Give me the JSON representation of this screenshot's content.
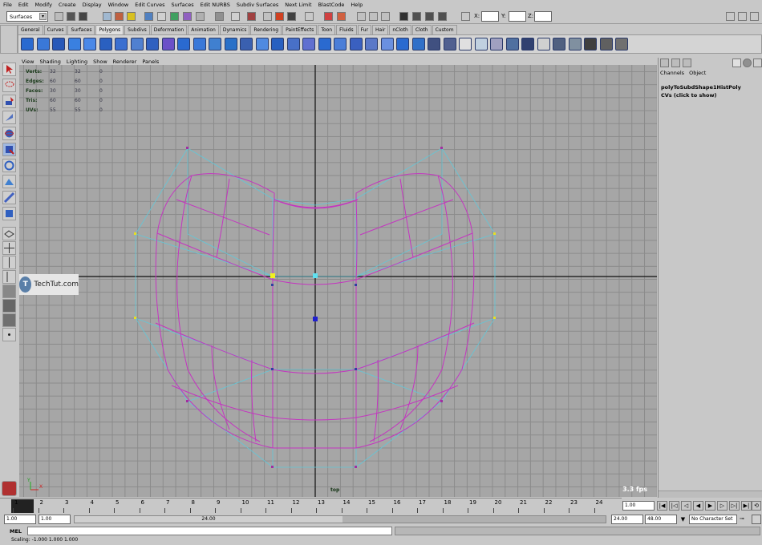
{
  "menubar": [
    "File",
    "Edit",
    "Modify",
    "Create",
    "Display",
    "Window",
    "Edit Curves",
    "Surfaces",
    "Edit NURBS",
    "Subdiv Surfaces",
    "Next Limit",
    "BlastCode",
    "Help"
  ],
  "status_line": {
    "mode": "Surfaces",
    "x_label": "X:",
    "y_label": "Y:",
    "z_label": "Z:"
  },
  "shelf_tabs": [
    "General",
    "Curves",
    "Surfaces",
    "Polygons",
    "Subdivs",
    "Deformation",
    "Animation",
    "Dynamics",
    "Rendering",
    "PaintEffects",
    "Toon",
    "Fluids",
    "Fur",
    "Hair",
    "nCloth",
    "Cloth",
    "Custom"
  ],
  "active_shelf_tab": "Polygons",
  "panel_menu": [
    "View",
    "Shading",
    "Lighting",
    "Show",
    "Renderer",
    "Panels"
  ],
  "hud": {
    "rows": [
      {
        "label": "Verts:",
        "a": "32",
        "b": "32",
        "c": "0"
      },
      {
        "label": "Edges:",
        "a": "60",
        "b": "60",
        "c": "0"
      },
      {
        "label": "Faces:",
        "a": "30",
        "b": "30",
        "c": "0"
      },
      {
        "label": "Tris:",
        "a": "60",
        "b": "60",
        "c": "0"
      },
      {
        "label": "UVs:",
        "a": "55",
        "b": "55",
        "c": "0"
      }
    ]
  },
  "viewport": {
    "camera": "top",
    "fps": "3.3 fps",
    "axis_y": "Y",
    "axis_x": "X"
  },
  "watermark": "TechTut.com",
  "channel_box": {
    "menu": [
      "Channels",
      "Object"
    ],
    "node": "polyToSubdShape1HistPoly",
    "cvs": "CVs (click to show)"
  },
  "timeline": {
    "ticks": [
      "1",
      "2",
      "3",
      "4",
      "5",
      "6",
      "7",
      "8",
      "9",
      "10",
      "11",
      "12",
      "13",
      "14",
      "15",
      "16",
      "17",
      "18",
      "19",
      "20",
      "21",
      "22",
      "23",
      "24"
    ],
    "current_frame": "1.00"
  },
  "range": {
    "start": "1.00",
    "inner_start": "1.00",
    "handle_label": "24.00",
    "inner_end": "24.00",
    "end": "48.00",
    "character_set": "No Character Set"
  },
  "command_line": {
    "label": "MEL"
  },
  "help_line": "Scaling: -1.000     1.000     1.000",
  "colors": {
    "grid": "#a6a6a6",
    "wire_magenta": "#c030c0",
    "cage_cyan": "#60c8d8"
  }
}
